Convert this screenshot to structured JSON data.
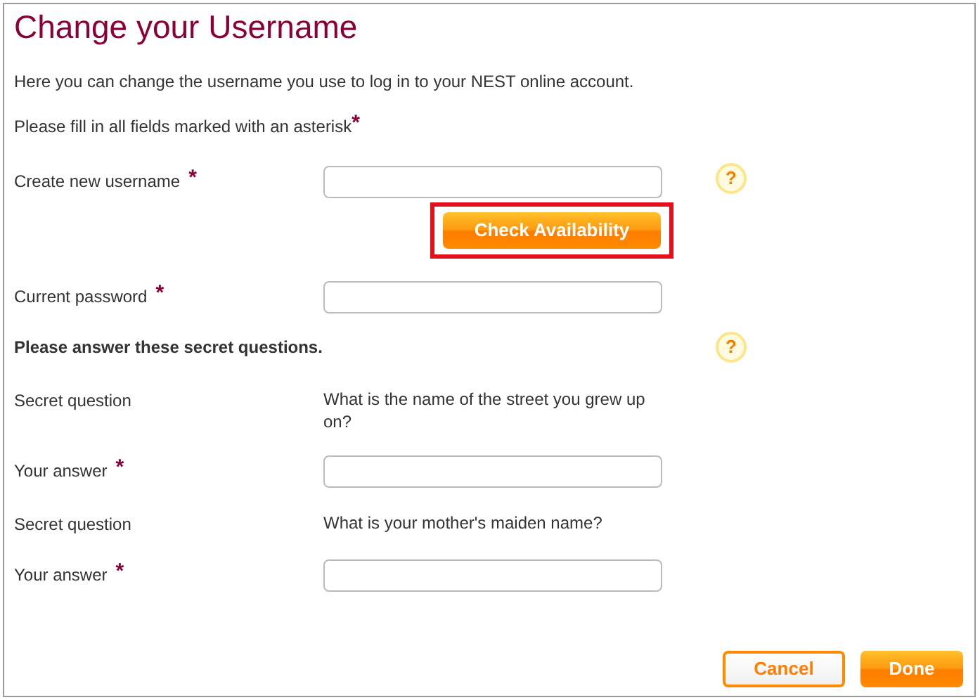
{
  "title": "Change your Username",
  "intro": "Here you can change the username you use to log in to your NEST online account.",
  "required_note": {
    "text": "Please fill in all fields marked with an asterisk",
    "asterisk": "*"
  },
  "rows": [
    {
      "kind": "input",
      "label": "Create new username",
      "asterisk": "*",
      "help": "?"
    },
    {
      "kind": "button",
      "label": "Check Availability",
      "highlighted": true
    },
    {
      "kind": "input",
      "label": "Current password",
      "asterisk": "*"
    },
    {
      "kind": "heading",
      "label": "Please answer these secret questions.",
      "help": "?"
    },
    {
      "kind": "question",
      "label": "Secret question",
      "value": "What is the name of the street you grew up on?"
    },
    {
      "kind": "input",
      "label": "Your answer",
      "asterisk": "*"
    },
    {
      "kind": "question",
      "label": "Secret question",
      "value": "What is your mother's maiden name?"
    },
    {
      "kind": "input",
      "label": "Your answer",
      "asterisk": "*"
    }
  ],
  "buttons": [
    {
      "label": "Cancel",
      "kind": "secondary"
    },
    {
      "label": "Done",
      "kind": "primary"
    }
  ]
}
